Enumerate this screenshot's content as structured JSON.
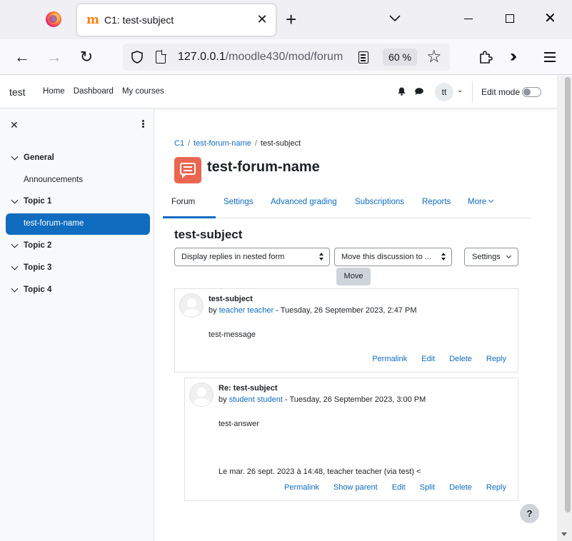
{
  "browser": {
    "tab_title": "C1: test-subject",
    "url_host": "127.0.0.1",
    "url_path": "/moodle430/mod/forum",
    "zoom": "60 %"
  },
  "topnav": {
    "site_name": "test",
    "links": [
      "Home",
      "Dashboard",
      "My courses"
    ],
    "avatar_initials": "tt",
    "edit_mode_label": "Edit mode"
  },
  "sidebar": {
    "items": [
      {
        "label": "General",
        "type": "section"
      },
      {
        "label": "Announcements",
        "type": "activity"
      },
      {
        "label": "Topic 1",
        "type": "section"
      },
      {
        "label": "test-forum-name",
        "type": "activity",
        "active": true
      },
      {
        "label": "Topic 2",
        "type": "section"
      },
      {
        "label": "Topic 3",
        "type": "section"
      },
      {
        "label": "Topic 4",
        "type": "section"
      }
    ]
  },
  "breadcrumb": [
    "C1",
    "test-forum-name",
    "test-subject"
  ],
  "page_title": "test-forum-name",
  "secondary_nav": [
    "Forum",
    "Settings",
    "Advanced grading",
    "Subscriptions",
    "Reports",
    "More"
  ],
  "discussion": {
    "title": "test-subject",
    "display_mode": "Display replies in nested form",
    "move_select": "Move this discussion to ...",
    "move_button": "Move",
    "settings_button": "Settings"
  },
  "posts": [
    {
      "subject": "test-subject",
      "by": "by ",
      "author": "teacher teacher",
      "date": " - Tuesday, 26 September 2023, 2:47 PM",
      "message": "test-message",
      "quote": "",
      "actions": [
        "Permalink",
        "Edit",
        "Delete",
        "Reply"
      ]
    },
    {
      "subject": "Re: test-subject",
      "by": "by ",
      "author": "student student",
      "date": " - Tuesday, 26 September 2023, 3:00 PM",
      "message": "test-answer",
      "quote": "Le mar. 26 sept. 2023 à 14:48, teacher teacher (via test) <",
      "actions": [
        "Permalink",
        "Show parent",
        "Edit",
        "Split",
        "Delete",
        "Reply"
      ]
    }
  ],
  "help_label": "?",
  "colors": {
    "accent": "#0f6cbf",
    "forum_icon": "#eb6651"
  }
}
